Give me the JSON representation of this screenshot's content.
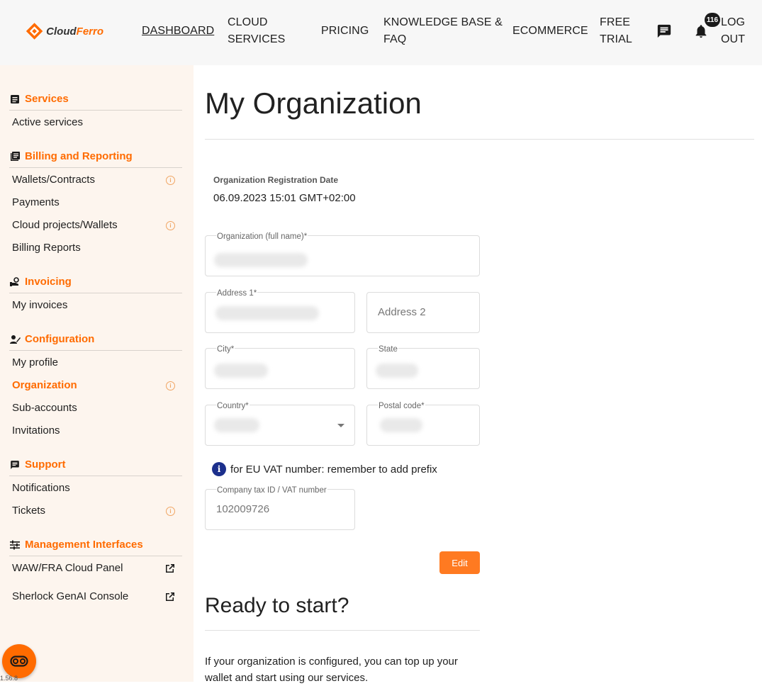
{
  "header": {
    "logo_text_a": "Cloud",
    "logo_text_b": "Ferro",
    "nav": [
      {
        "label": "DASHBOARD",
        "l1": "DASHBOARD",
        "l2": ""
      },
      {
        "label": "CLOUD SERVICES",
        "l1": "CLOUD",
        "l2": "SERVICES"
      },
      {
        "label": "PRICING",
        "l1": "PRICING",
        "l2": ""
      },
      {
        "label": "KNOWLEDGE BASE & FAQ",
        "l1": "KNOWLEDGE BASE &",
        "l2": "FAQ"
      },
      {
        "label": "ECOMMERCE",
        "l1": "ECOMMERCE",
        "l2": ""
      },
      {
        "label": "FREE TRIAL",
        "l1": "FREE",
        "l2": "TRIAL"
      },
      {
        "label": "LOG OUT",
        "l1": "LOG",
        "l2": "OUT"
      }
    ],
    "notification_count": "116"
  },
  "sidebar": {
    "sections": [
      {
        "title": "Services",
        "icon": "services-icon",
        "items": [
          {
            "label": "Active services"
          }
        ]
      },
      {
        "title": "Billing and Reporting",
        "icon": "billing-icon",
        "items": [
          {
            "label": "Wallets/Contracts",
            "info": true
          },
          {
            "label": "Payments"
          },
          {
            "label": "Cloud projects/Wallets",
            "info": true
          },
          {
            "label": "Billing Reports"
          }
        ]
      },
      {
        "title": "Invoicing",
        "icon": "invoice-icon",
        "items": [
          {
            "label": "My invoices"
          }
        ]
      },
      {
        "title": "Configuration",
        "icon": "configuration-icon",
        "items": [
          {
            "label": "My profile"
          },
          {
            "label": "Organization",
            "info": true,
            "active": true
          },
          {
            "label": "Sub-accounts"
          },
          {
            "label": "Invitations"
          }
        ]
      },
      {
        "title": "Support",
        "icon": "support-icon",
        "items": [
          {
            "label": "Notifications"
          },
          {
            "label": "Tickets",
            "info": true
          }
        ]
      },
      {
        "title": "Management Interfaces",
        "icon": "management-icon",
        "items": [
          {
            "label": "WAW/FRA Cloud Panel",
            "external": true
          },
          {
            "label": "Sherlock GenAI Console",
            "external": true
          }
        ]
      }
    ],
    "version": "1.56.8"
  },
  "main": {
    "title": "My Organization",
    "registration": {
      "label": "Organization Registration Date",
      "value": "06.09.2023 15:01 GMT+02:00"
    },
    "form": {
      "org_name_label": "Organization (full name)*",
      "address1_label": "Address 1*",
      "address2_placeholder": "Address 2",
      "city_label": "City*",
      "state_label": "State",
      "country_label": "Country*",
      "postal_label": "Postal code*",
      "vat_note": "for EU VAT number: remember to add prefix",
      "tax_label": "Company tax ID / VAT number",
      "tax_value": "102009726",
      "edit_label": "Edit"
    },
    "ready": {
      "title": "Ready to start?",
      "text": "If your organization is configured, you can top up your wallet and start using our services."
    }
  },
  "colors": {
    "accent": "#ff6b00",
    "sidebar_bg": "#fdf5ee",
    "header_bg": "#f7f7f7",
    "info_blue": "#1c2f8c"
  }
}
